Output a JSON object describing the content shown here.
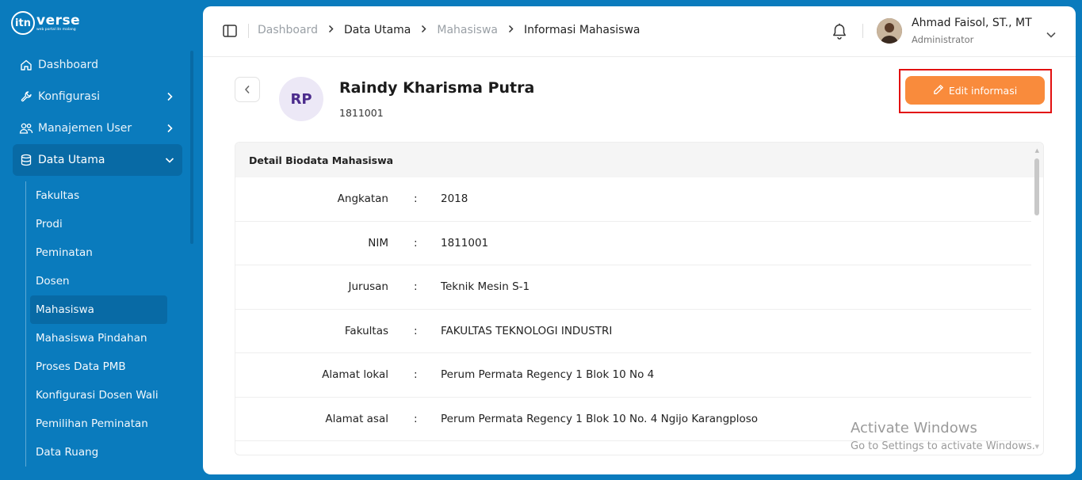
{
  "brand": {
    "logo_mark": "itn",
    "name": "verse",
    "tagline": "web portal itn malang"
  },
  "sidebar": {
    "items": [
      {
        "label": "Dashboard",
        "icon": "home-icon"
      },
      {
        "label": "Konfigurasi",
        "icon": "wrench-icon"
      },
      {
        "label": "Manajemen User",
        "icon": "users-icon"
      },
      {
        "label": "Data Utama",
        "icon": "database-icon"
      }
    ],
    "submenu": [
      "Fakultas",
      "Prodi",
      "Peminatan",
      "Dosen",
      "Mahasiswa",
      "Mahasiswa Pindahan",
      "Proses Data PMB",
      "Konfigurasi Dosen Wali",
      "Pemilihan Peminatan",
      "Data Ruang"
    ],
    "active_submenu": "Mahasiswa"
  },
  "header": {
    "breadcrumb": [
      "Dashboard",
      "Data Utama",
      "Mahasiswa",
      "Informasi Mahasiswa"
    ],
    "user": {
      "name": "Ahmad Faisol, ST., MT",
      "role": "Administrator"
    }
  },
  "profile": {
    "initials": "RP",
    "name": "Raindy Kharisma Putra",
    "nim": "1811001",
    "edit_label": "Edit informasi"
  },
  "detail": {
    "title": "Detail Biodata Mahasiswa",
    "separator": ":",
    "rows": [
      {
        "label": "Angkatan",
        "value": "2018"
      },
      {
        "label": "NIM",
        "value": "1811001"
      },
      {
        "label": "Jurusan",
        "value": "Teknik Mesin S-1"
      },
      {
        "label": "Fakultas",
        "value": "FAKULTAS TEKNOLOGI INDUSTRI"
      },
      {
        "label": "Alamat lokal",
        "value": "Perum Permata Regency 1 Blok 10 No 4"
      },
      {
        "label": "Alamat asal",
        "value": "Perum Permata Regency 1 Blok 10 No. 4 Ngijo Karangploso"
      }
    ]
  },
  "watermark": {
    "line1": "Activate Windows",
    "line2": "Go to Settings to activate Windows."
  },
  "colors": {
    "sidebar_bg": "#0a7bbd",
    "accent": "#f98b3c",
    "highlight": "#e20f0f",
    "avatar_text": "#4b2b8c"
  }
}
